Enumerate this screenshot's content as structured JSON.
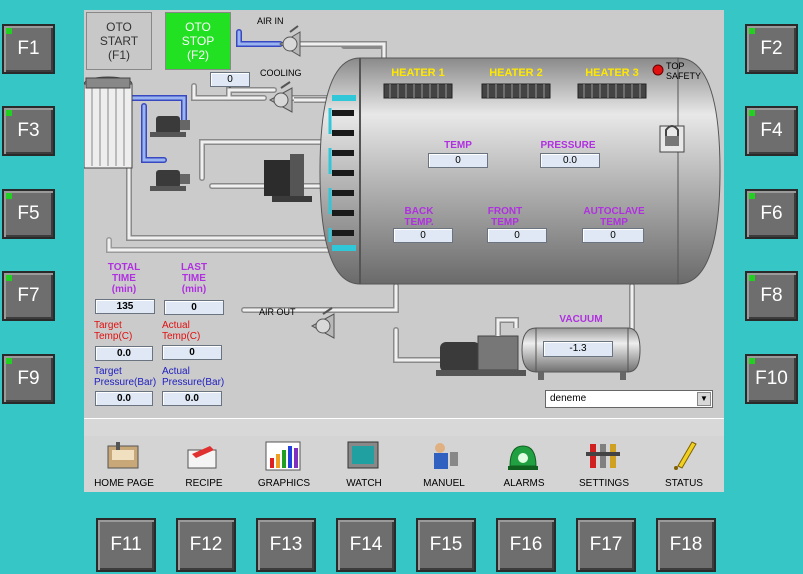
{
  "fkeys": {
    "left": [
      "F1",
      "F3",
      "F5",
      "F7",
      "F9"
    ],
    "right": [
      "F2",
      "F4",
      "F6",
      "F8",
      "F10"
    ],
    "bottom": [
      "F11",
      "F12",
      "F13",
      "F14",
      "F15",
      "F16",
      "F17",
      "F18"
    ]
  },
  "controls": {
    "start": {
      "line1": "OTO",
      "line2": "START",
      "line3": "(F1)"
    },
    "stop": {
      "line1": "OTO",
      "line2": "STOP",
      "line3": "(F2)"
    }
  },
  "process": {
    "air_in": "AIR IN",
    "cooling": "COOLING",
    "air_out": "AIR OUT",
    "cooling_value": "0",
    "heater1": "HEATER 1",
    "heater2": "HEATER 2",
    "heater3": "HEATER 3",
    "top_safety_1": "TOP",
    "top_safety_2": "SAFETY",
    "temp_label": "TEMP",
    "temp_value": "0",
    "pressure_label": "PRESSURE",
    "pressure_value": "0.0",
    "back_temp_1": "BACK",
    "back_temp_2": "TEMP.",
    "back_temp_value": "0",
    "front_temp_1": "FRONT",
    "front_temp_2": "TEMP",
    "front_temp_value": "0",
    "autoclave_temp_1": "AUTOCLAVE",
    "autoclave_temp_2": "TEMP",
    "autoclave_temp_value": "0",
    "vacuum_label": "VACUUM",
    "vacuum_value": "-1.3"
  },
  "stats": {
    "total_time_1": "TOTAL",
    "total_time_2": "TIME",
    "total_time_3": "(min)",
    "total_time_value": "135",
    "last_time_1": "LAST",
    "last_time_2": "TIME",
    "last_time_3": "(min)",
    "last_time_value": "0",
    "target_temp_1": "Target",
    "target_temp_2": "Temp(C)",
    "target_temp_value": "0.0",
    "actual_temp_1": "Actual",
    "actual_temp_2": "Temp(C)",
    "actual_temp_value": "0",
    "target_pressure_1": "Target",
    "target_pressure_2": "Pressure(Bar)",
    "target_pressure_value": "0.0",
    "actual_pressure_1": "Actual",
    "actual_pressure_2": "Pressure(Bar)",
    "actual_pressure_value": "0.0"
  },
  "recipe_select": {
    "value": "deneme"
  },
  "nav": [
    {
      "label": "HOME PAGE",
      "icon": "home-page-icon"
    },
    {
      "label": "RECIPE",
      "icon": "recipe-icon"
    },
    {
      "label": "GRAPHICS",
      "icon": "graphics-icon"
    },
    {
      "label": "WATCH",
      "icon": "monitor-icon"
    },
    {
      "label": "MANUEL",
      "icon": "manual-icon"
    },
    {
      "label": "ALARMS",
      "icon": "alarm-icon"
    },
    {
      "label": "SETTINGS",
      "icon": "settings-icon"
    },
    {
      "label": "STATUS",
      "icon": "status-icon"
    }
  ],
  "colors": {
    "background": "#36c6c6",
    "stop_active": "#22e022",
    "heater_label": "#ffe800",
    "value_label": "#b030e0",
    "target_red": "#e01010",
    "target_blue": "#2020c0"
  }
}
